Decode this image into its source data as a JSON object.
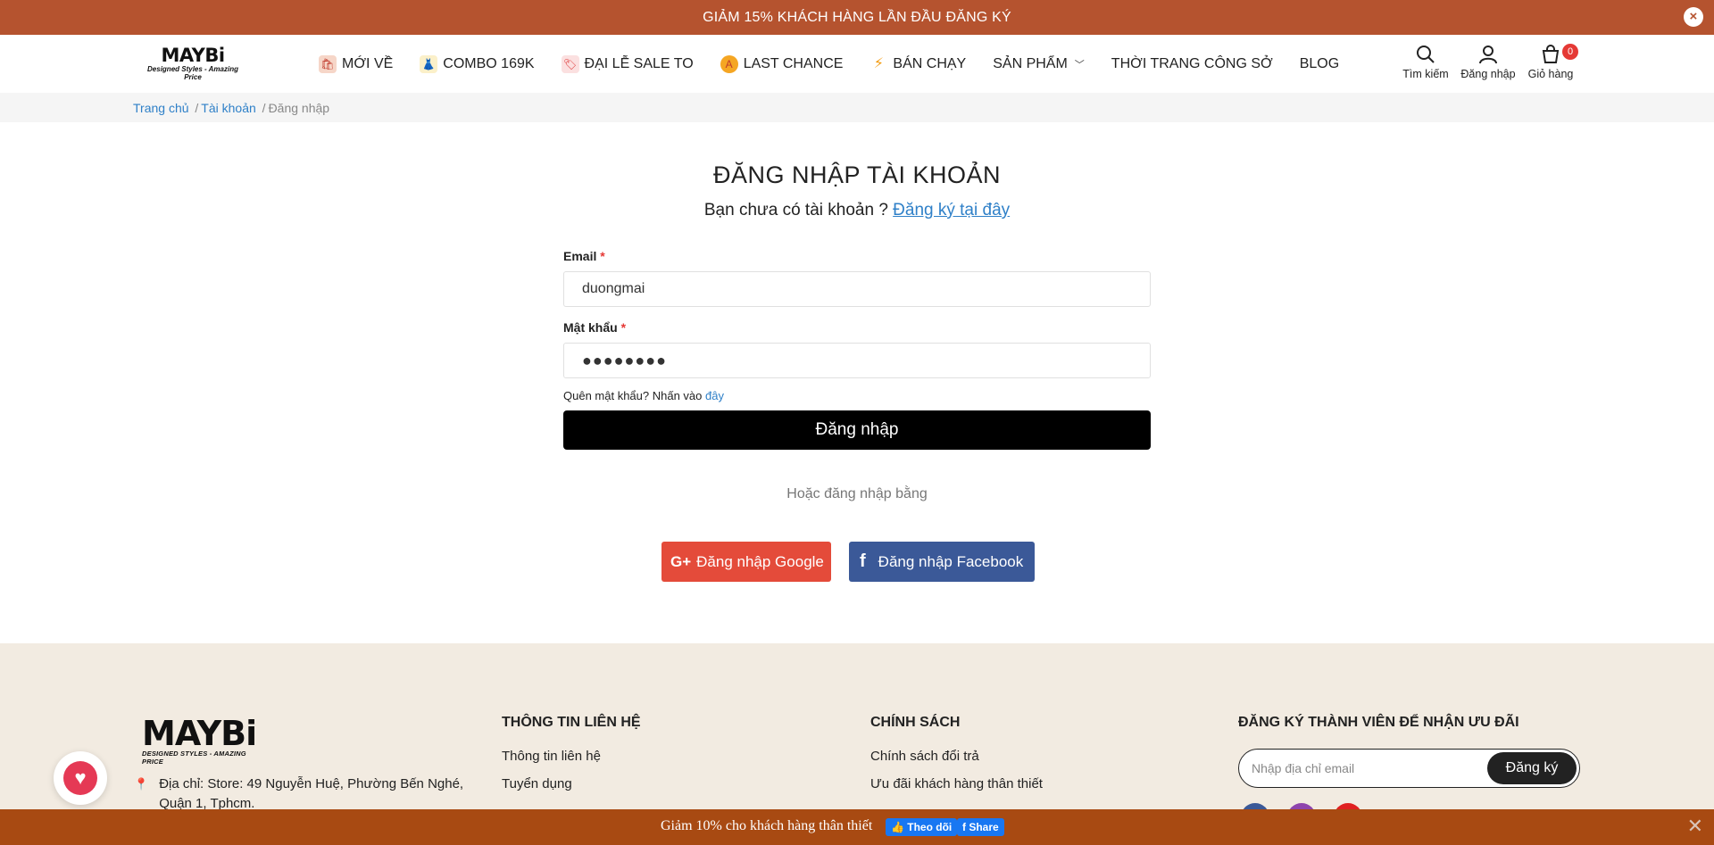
{
  "topbar": {
    "text": "GIẢM 15% KHÁCH HÀNG LẦN ĐẦU ĐĂNG KÝ",
    "close": "×"
  },
  "header": {
    "logo_main": "MAYBi",
    "logo_sub": "Designed Styles - Amazing Price",
    "nav": [
      {
        "label": "MỚI VỀ",
        "icon": "shopping-bags-icon"
      },
      {
        "label": "COMBO 169K",
        "icon": "dress-icon"
      },
      {
        "label": "ĐẠI LỄ SALE TO",
        "icon": "sale-tag-icon"
      },
      {
        "label": "LAST CHANCE",
        "icon": "alert-badge-icon"
      },
      {
        "label": "BÁN CHẠY",
        "icon": "lightning-icon"
      },
      {
        "label": "SẢN PHẨM",
        "icon": "chevron-down-icon"
      },
      {
        "label": "THỜI TRANG CÔNG SỞ"
      },
      {
        "label": "BLOG"
      }
    ],
    "actions": {
      "search": "Tìm kiếm",
      "login": "Đăng nhập",
      "cart": "Giỏ hàng",
      "cart_count": "0"
    }
  },
  "breadcrumb": {
    "home": "Trang chủ",
    "account": "Tài khoản",
    "current": "Đăng nhập",
    "sep": "/"
  },
  "login": {
    "title": "ĐĂNG NHẬP TÀI KHOẢN",
    "no_account": "Bạn chưa có tài khoản ?",
    "register_link": "Đăng ký tại đây",
    "email_label": "Email",
    "email_value": "duongmai",
    "password_label": "Mật khẩu",
    "password_value": "●●●●●●●●",
    "required_mark": "*",
    "forgot_text": "Quên mật khẩu? Nhấn vào",
    "forgot_link": "đây",
    "submit": "Đăng nhập",
    "or_text": "Hoặc đăng nhập bằng",
    "google": "Đăng nhập Google",
    "google_icon": "G+",
    "facebook": "Đăng nhập Facebook",
    "facebook_icon": "f"
  },
  "footer": {
    "logo_main": "MAYBi",
    "logo_sub": "DESIGNED STYLES - AMAZING PRICE",
    "address": "Địa chỉ: Store: 49 Nguyễn Huệ, Phường Bến Nghé, Quận 1, Tphcm.",
    "contact_title": "THÔNG TIN LIÊN HỆ",
    "contact_links": [
      "Thông tin liên hệ",
      "Tuyển dụng"
    ],
    "policy_title": "CHÍNH SÁCH",
    "policy_links": [
      "Chính sách đổi trả",
      "Ưu đãi khách hàng thân thiết"
    ],
    "newsletter_title": "ĐĂNG KÝ THÀNH VIÊN ĐỂ NHẬN ƯU ĐÃI",
    "newsletter_placeholder": "Nhập địa chỉ email",
    "newsletter_button": "Đăng ký"
  },
  "bottombar": {
    "text": "Giảm 10% cho khách hàng thân thiết",
    "follow": "👍 Theo dõi",
    "share": "f Share",
    "close": "✕"
  },
  "colors": {
    "topbar": "#b5532f",
    "bottombar": "#a84a12",
    "link": "#2f80c8",
    "google": "#e44b3a",
    "facebook": "#3b5998",
    "footer_bg": "#f2ebe1"
  }
}
